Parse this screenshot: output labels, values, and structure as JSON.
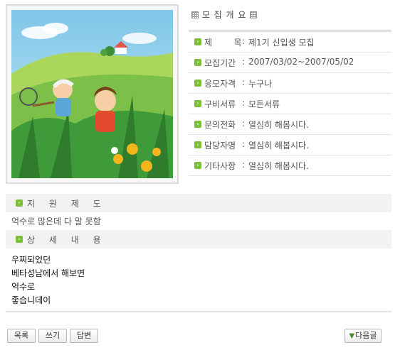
{
  "summary": {
    "title": "모 집 개 요",
    "icon": "grid-icon"
  },
  "info_rows": [
    {
      "label": "제        목",
      "value": "제1기 신입생 모집"
    },
    {
      "label": "모집기간",
      "value": "2007/03/02~2007/05/02"
    },
    {
      "label": "응모자격",
      "value": "누구나"
    },
    {
      "label": "구비서류",
      "value": "모든서류"
    },
    {
      "label": "문의전화",
      "value": "열심히 해봅시다."
    },
    {
      "label": "담당자명",
      "value": "열심히 해봅시다."
    },
    {
      "label": "기타사항",
      "value": "열심히 해봅시다."
    }
  ],
  "separator": ":",
  "support": {
    "title": "지 원 제 도",
    "text": "억수로 많은데 다 말 못함"
  },
  "details": {
    "title": "상 세 내 용",
    "lines": [
      "우찌되었던",
      "베타성남에서 해보면",
      "억수로",
      "좋습니데이"
    ]
  },
  "buttons": {
    "list": "목록",
    "write": "쓰기",
    "reply": "답변",
    "next": "다음글"
  },
  "colors": {
    "accent_green": "#7bbf3a",
    "section_bg": "#f2f2f2"
  }
}
